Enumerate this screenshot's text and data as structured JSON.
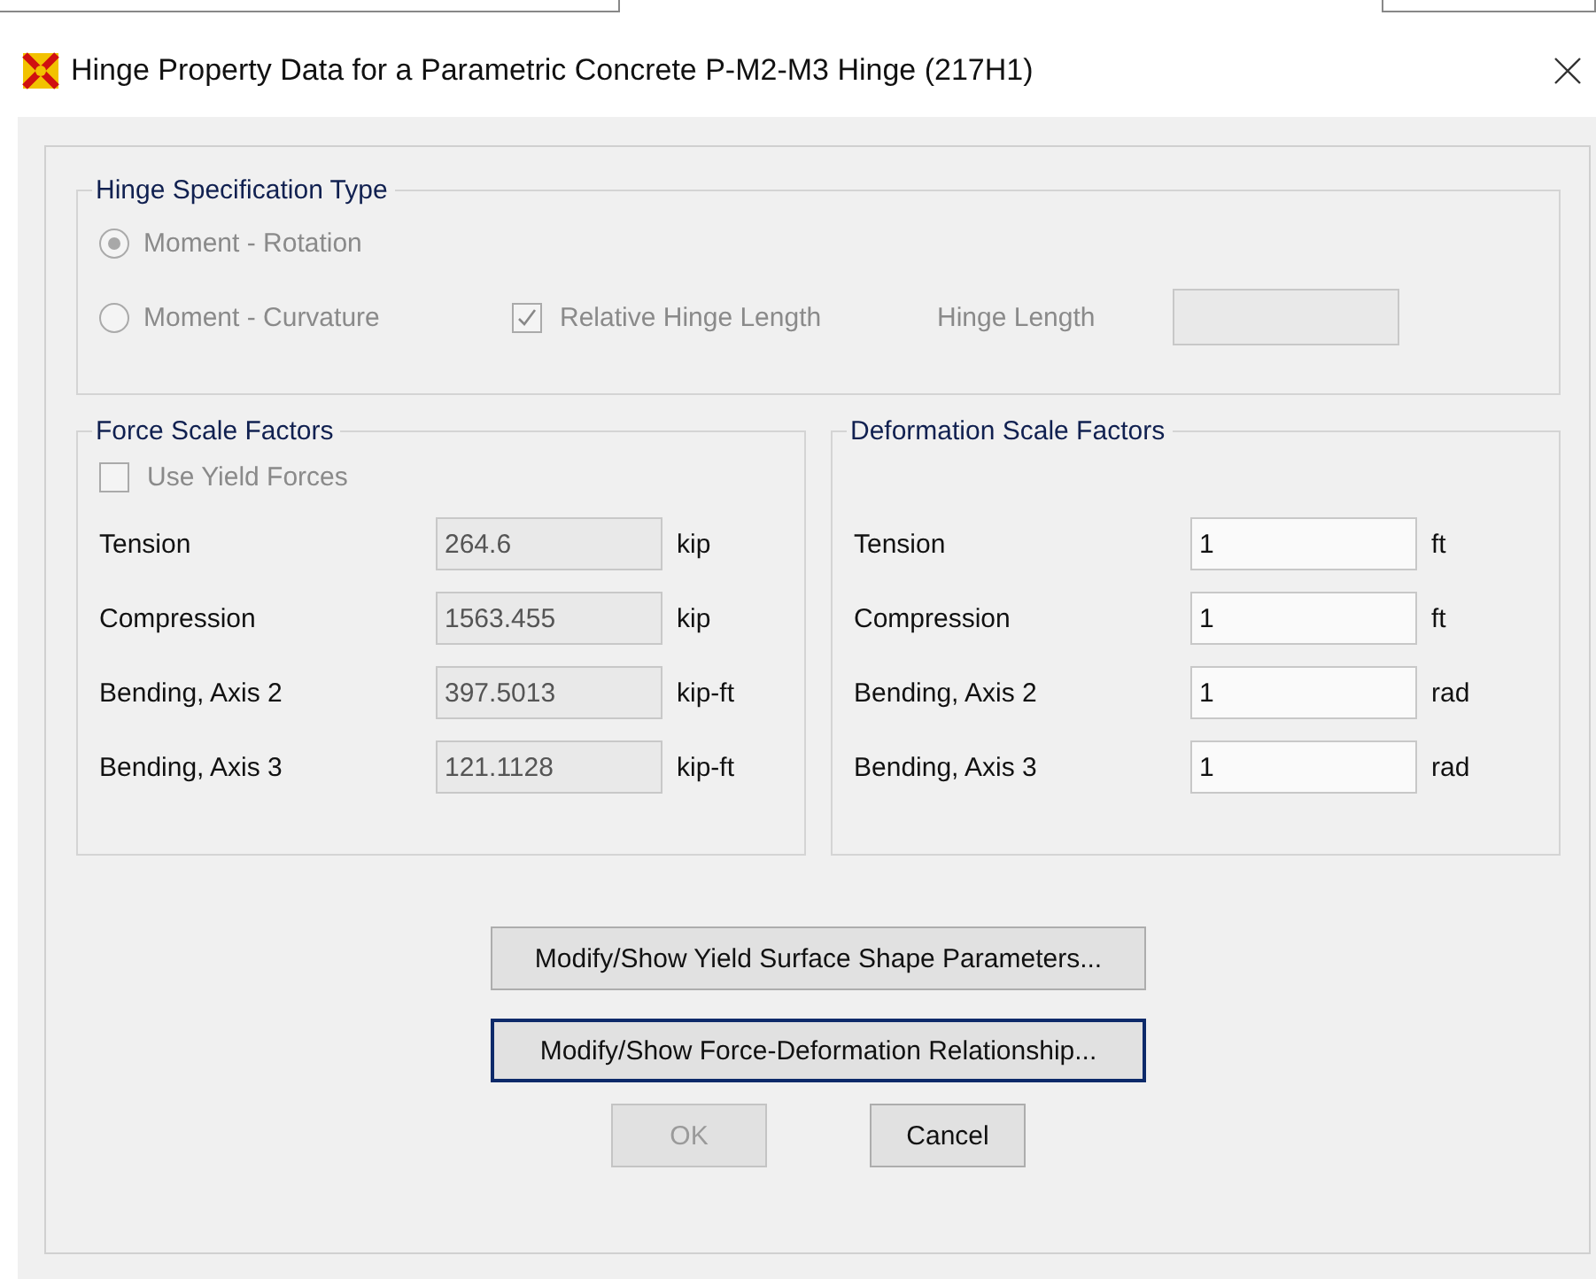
{
  "window": {
    "title": "Hinge Property Data for a Parametric Concrete P-M2-M3 Hinge  (217H1)"
  },
  "hinge_spec": {
    "title": "Hinge Specification Type",
    "options": [
      {
        "label": "Moment - Rotation",
        "selected": true,
        "disabled": true
      },
      {
        "label": "Moment - Curvature",
        "selected": false,
        "disabled": true
      }
    ],
    "relative_hinge_length": {
      "label": "Relative Hinge Length",
      "checked": true,
      "disabled": true
    },
    "hinge_length": {
      "label": "Hinge Length",
      "disabled": true
    }
  },
  "force_scale": {
    "title": "Force Scale Factors",
    "use_yield_forces": {
      "label": "Use Yield Forces",
      "checked": false,
      "disabled": true
    },
    "rows": [
      {
        "label": "Tension",
        "value": "264.6",
        "unit": "kip",
        "disabled": true
      },
      {
        "label": "Compression",
        "value": "1563.455",
        "unit": "kip",
        "disabled": true
      },
      {
        "label": "Bending, Axis 2",
        "value": "397.5013",
        "unit": "kip-ft",
        "disabled": true
      },
      {
        "label": "Bending, Axis 3",
        "value": "121.1128",
        "unit": "kip-ft",
        "disabled": true
      }
    ]
  },
  "deformation_scale": {
    "title": "Deformation Scale Factors",
    "rows": [
      {
        "label": "Tension",
        "value": "1",
        "unit": "ft",
        "disabled": false
      },
      {
        "label": "Compression",
        "value": "1",
        "unit": "ft",
        "disabled": false
      },
      {
        "label": "Bending, Axis 2",
        "value": "1",
        "unit": "rad",
        "disabled": false
      },
      {
        "label": "Bending, Axis 3",
        "value": "1",
        "unit": "rad",
        "disabled": false
      }
    ]
  },
  "buttons": [
    {
      "label": "Modify/Show Yield Surface Shape Parameters...",
      "focused": false
    },
    {
      "label": "Modify/Show Force-Deformation Relationship...",
      "focused": true
    }
  ],
  "actions": [
    {
      "label": "OK",
      "disabled": true
    },
    {
      "label": "Cancel",
      "disabled": false
    }
  ]
}
